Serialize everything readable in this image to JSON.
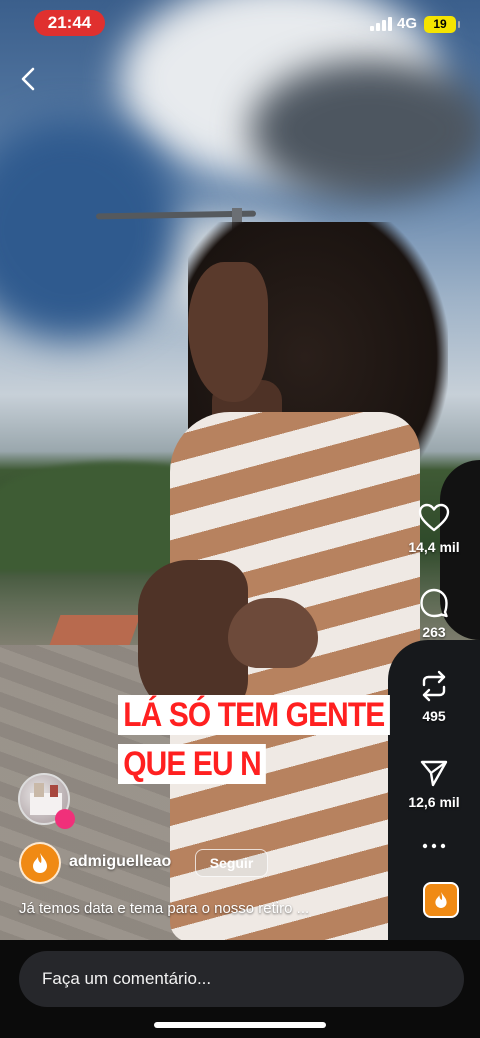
{
  "status_bar": {
    "time": "21:44",
    "network": "4G",
    "battery": "19"
  },
  "overlay_text": {
    "line1": "LÁ SÓ TEM GENTE",
    "line2": "QUE EU N"
  },
  "actions": {
    "likes": "14,4 mil",
    "comments": "263",
    "reposts": "495",
    "shares": "12,6 mil"
  },
  "author": {
    "username": "admiguelleao",
    "follow_label": "Seguir"
  },
  "caption": "Já temos data e tema para o nosso retiro ...",
  "comment_input": {
    "placeholder": "Faça um comentário..."
  },
  "colors": {
    "time_pill": "#e0302f",
    "battery": "#f5e400",
    "sticker_text": "#ff2020",
    "brand_orange": "#f08a14"
  }
}
